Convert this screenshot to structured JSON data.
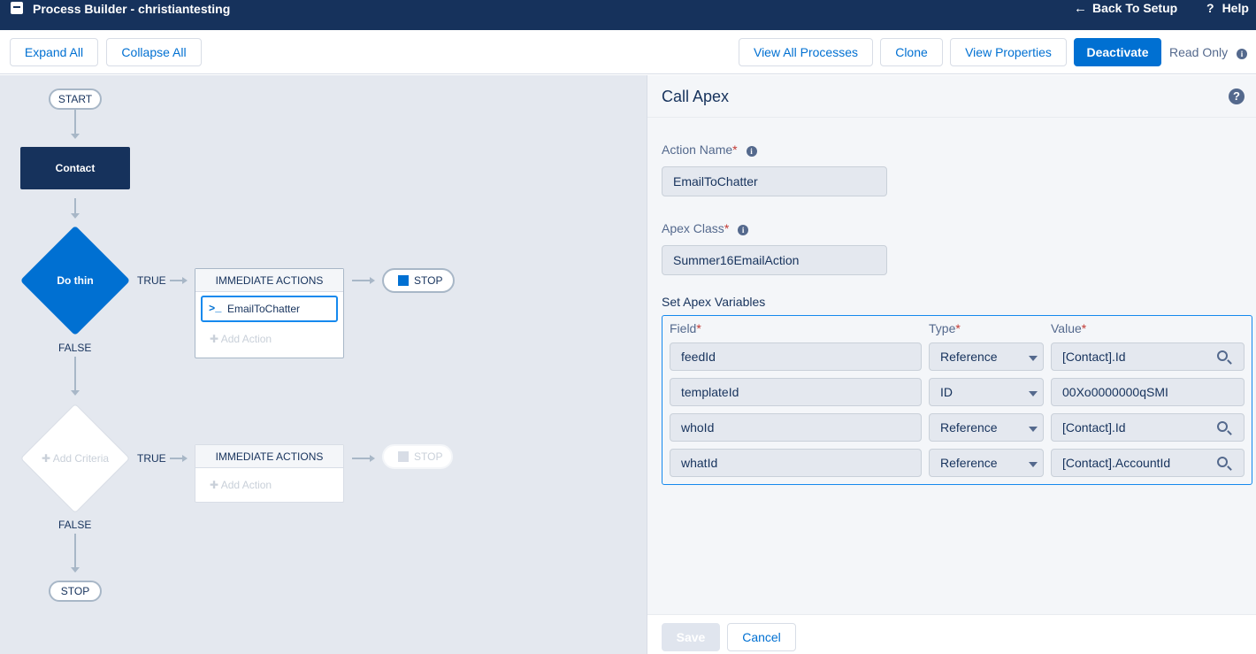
{
  "header": {
    "app_title": "Process Builder - christiantesting",
    "back_label": "Back To Setup",
    "help_label": "Help"
  },
  "toolbar": {
    "expand_all": "Expand All",
    "collapse_all": "Collapse All",
    "view_all_processes": "View All Processes",
    "clone": "Clone",
    "view_properties": "View Properties",
    "deactivate": "Deactivate",
    "read_only": "Read Only"
  },
  "canvas": {
    "start": "START",
    "object_name": "Contact",
    "criteria_1": "Do thin",
    "criteria_2": "Add Criteria",
    "true_label": "TRUE",
    "false_label": "FALSE",
    "immediate_actions": "IMMEDIATE ACTIONS",
    "action_name": "EmailToChatter",
    "add_action": "Add Action",
    "stop": "STOP"
  },
  "panel": {
    "title": "Call Apex",
    "action_name_label": "Action Name",
    "action_name_value": "EmailToChatter",
    "apex_class_label": "Apex Class",
    "apex_class_value": "Summer16EmailAction",
    "set_vars_label": "Set Apex Variables",
    "columns": {
      "field": "Field",
      "type": "Type",
      "value": "Value"
    },
    "rows": [
      {
        "field": "feedId",
        "type": "Reference",
        "value": "[Contact].Id"
      },
      {
        "field": "templateId",
        "type": "ID",
        "value": "00Xo0000000qSMI"
      },
      {
        "field": "whoId",
        "type": "Reference",
        "value": "[Contact].Id"
      },
      {
        "field": "whatId",
        "type": "Reference",
        "value": "[Contact].AccountId"
      }
    ],
    "save": "Save",
    "cancel": "Cancel"
  },
  "colors": {
    "header_bg": "#16325c",
    "brand_blue": "#0070d2",
    "canvas_bg": "#e4e8ef"
  }
}
